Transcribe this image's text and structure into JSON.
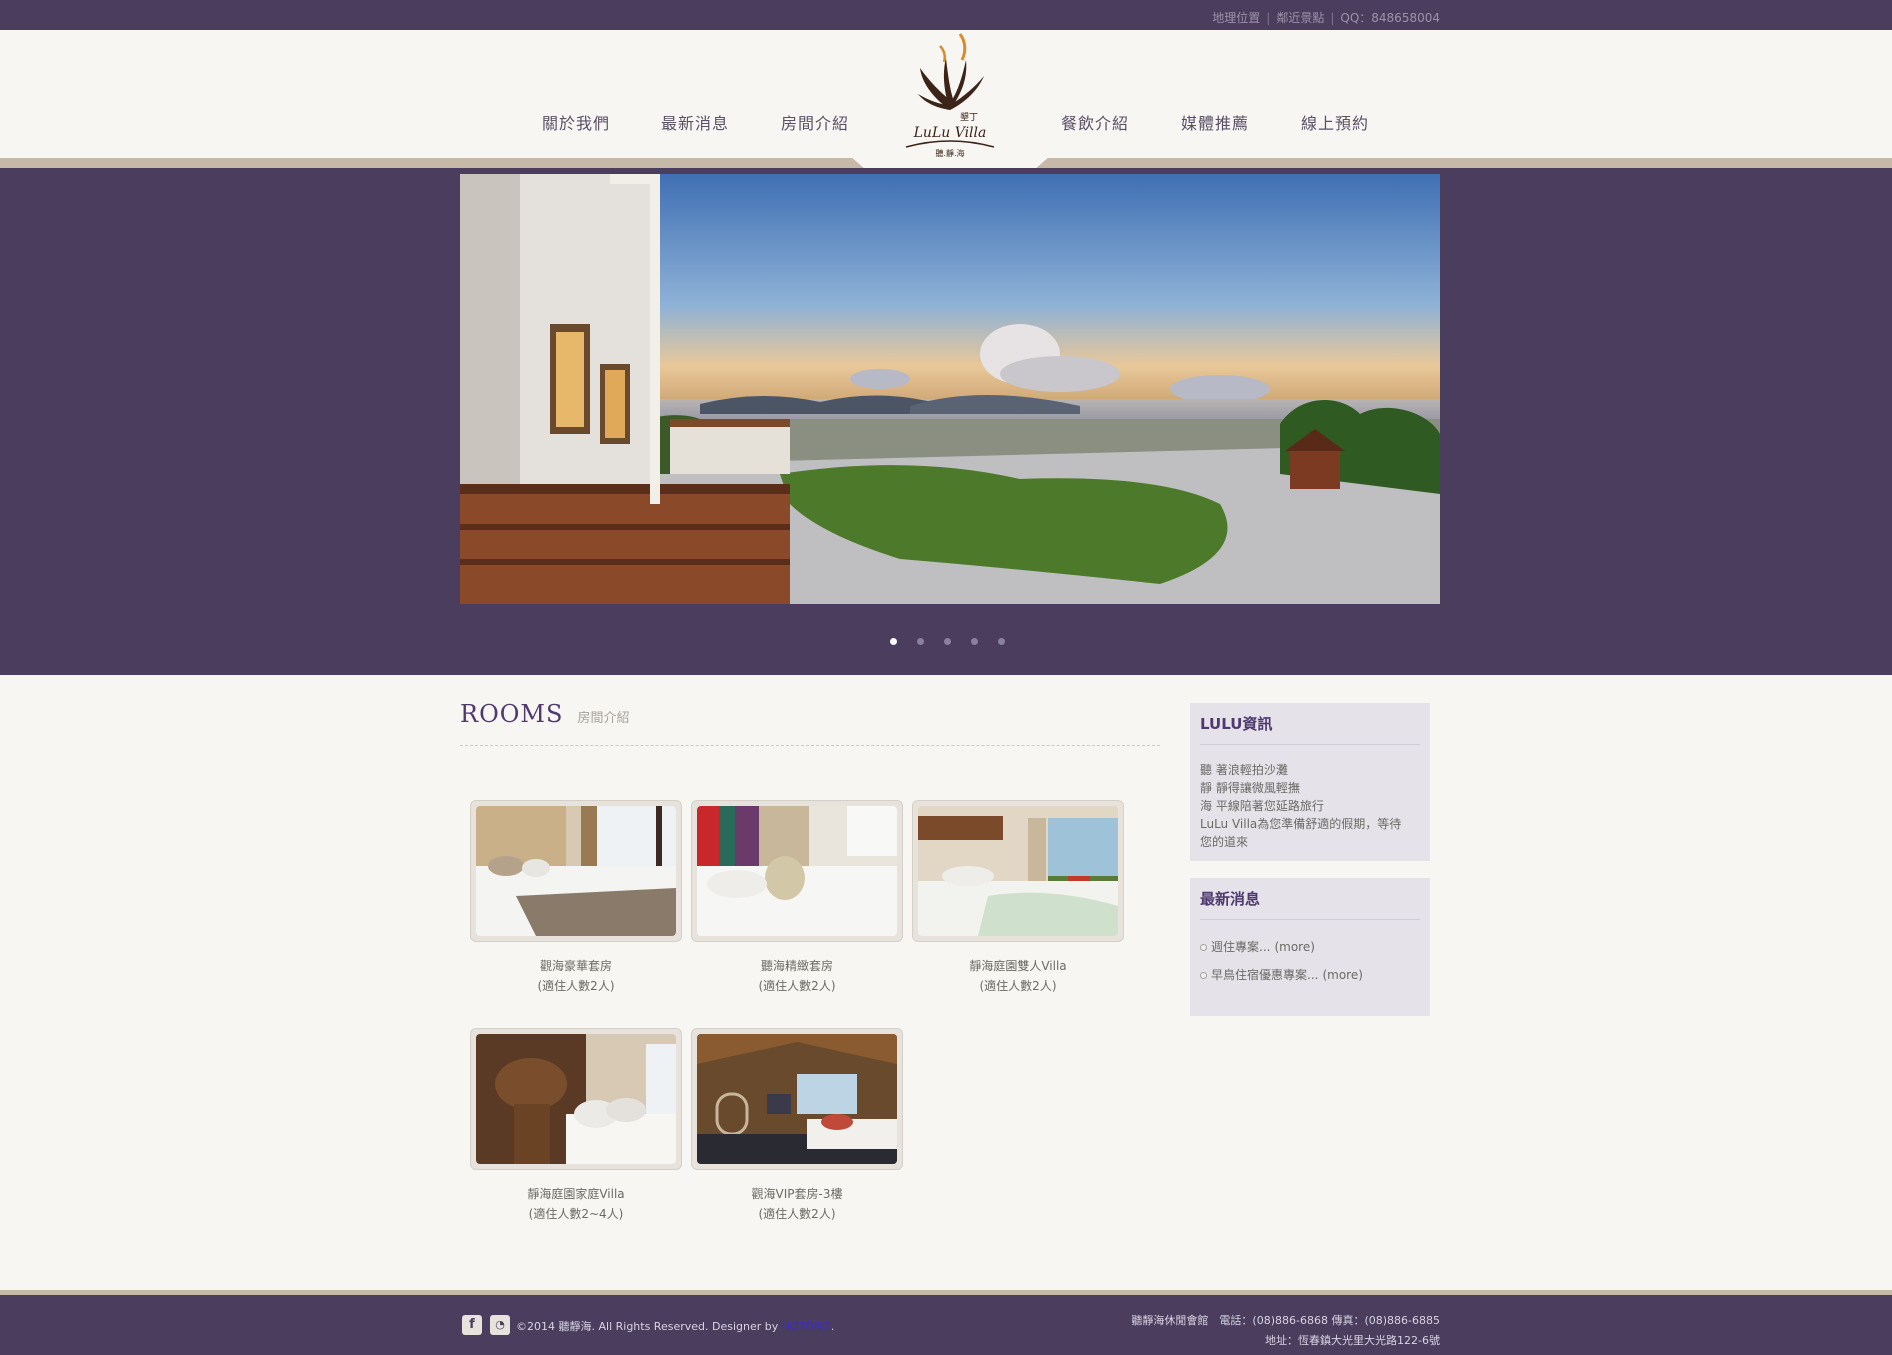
{
  "topbar": {
    "links": [
      "地理位置",
      "鄰近景點",
      "QQ：848658004"
    ],
    "separator": "|"
  },
  "logo": {
    "top_text": "墾丁",
    "brand": "LuLu Villa",
    "bottom_text": "聽.靜.海"
  },
  "nav": {
    "left": [
      "關於我們",
      "最新消息",
      "房間介紹"
    ],
    "right": [
      "餐飲介紹",
      "媒體推薦",
      "線上預約"
    ]
  },
  "hero": {
    "slide_count": 5,
    "active_index": 0
  },
  "rooms": {
    "title": "ROOMS",
    "subtitle": "房間介紹",
    "items": [
      {
        "name": "觀海豪華套房",
        "capacity": "(適住人數2人)"
      },
      {
        "name": "聽海精緻套房",
        "capacity": "(適住人數2人)"
      },
      {
        "name": "靜海庭園雙人Villa",
        "capacity": "(適住人數2人)"
      },
      {
        "name": "靜海庭園家庭Villa",
        "capacity": "(適住人數2~4人)"
      },
      {
        "name": "觀海VIP套房-3樓",
        "capacity": "(適住人數2人)"
      }
    ]
  },
  "sidebar": {
    "info": {
      "title": "LULU資訊",
      "lines": [
        "聽 著浪輕拍沙灘",
        "靜 靜得讓微風輕撫",
        "海 平線陪著您延路旅行",
        "LuLu Villa為您準備舒適的假期，等待",
        "您的道來"
      ]
    },
    "news": {
      "title": "最新消息",
      "items": [
        {
          "text": "週住專案...",
          "more": "(more)"
        },
        {
          "text": "早鳥住宿優惠專案...",
          "more": "(more)"
        }
      ]
    }
  },
  "footer": {
    "icons": [
      "f",
      "rss"
    ],
    "copyright_prefix": "©2014 聽靜海. All Rights Reserved. Designer by ",
    "designer": "HOTONG",
    "copyright_suffix": ".",
    "contact_line1": "聽靜海休閒會館　電話：(08)886-6868 傳真：(08)886-6885",
    "contact_line2": "地址：恆春鎮大光里大光路122-6號"
  }
}
